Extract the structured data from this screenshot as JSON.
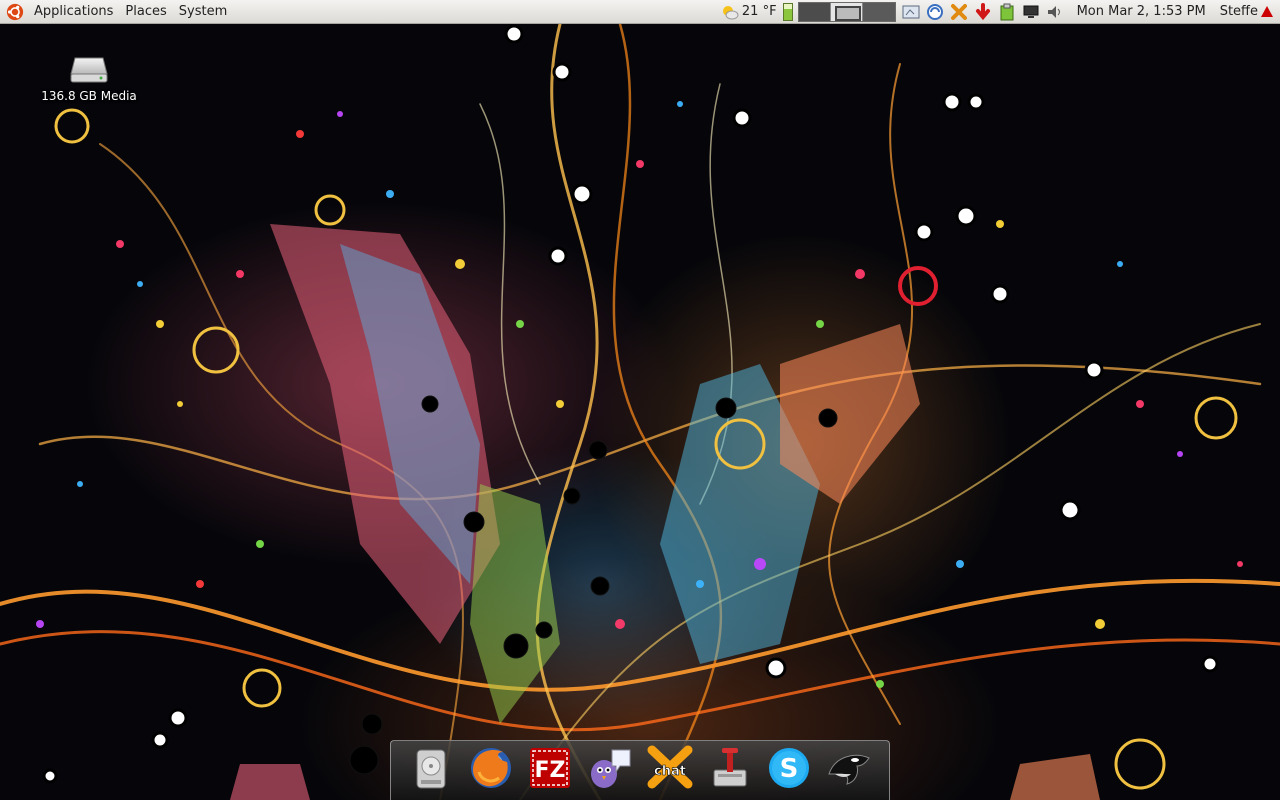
{
  "top_panel": {
    "menus": [
      "Applications",
      "Places",
      "System"
    ],
    "weather": "21 °F",
    "clock": "Mon Mar  2,  1:53 PM",
    "user": "Steffe",
    "icons": [
      "ubuntu-logo-icon",
      "weather-icon",
      "battery-icon",
      "workspace-switcher",
      "show-desktop-icon",
      "network-icon",
      "tools-icon",
      "update-icon",
      "clipboard-icon",
      "display-icon",
      "volume-icon",
      "alert-icon"
    ]
  },
  "desktop": {
    "icons": [
      {
        "label": "136.8 GB Media",
        "icon": "hard-drive-icon"
      }
    ]
  },
  "dock": {
    "items": [
      {
        "name": "hard-drive",
        "icon": "hard-drive-icon"
      },
      {
        "name": "firefox",
        "icon": "firefox-icon"
      },
      {
        "name": "filezilla",
        "icon": "filezilla-icon",
        "text": "FZ"
      },
      {
        "name": "pidgin",
        "icon": "pidgin-icon"
      },
      {
        "name": "xchat",
        "icon": "xchat-icon",
        "text": "chat"
      },
      {
        "name": "transmission",
        "icon": "transmission-icon"
      },
      {
        "name": "skype",
        "icon": "skype-icon",
        "text": "S"
      },
      {
        "name": "orca",
        "icon": "orca-icon"
      }
    ]
  },
  "colors": {
    "panel_bg": "#dcdad5",
    "desktop_bg": "#06060a",
    "ubuntu_orange": "#dd4814",
    "alert_red": "#cc0000"
  }
}
